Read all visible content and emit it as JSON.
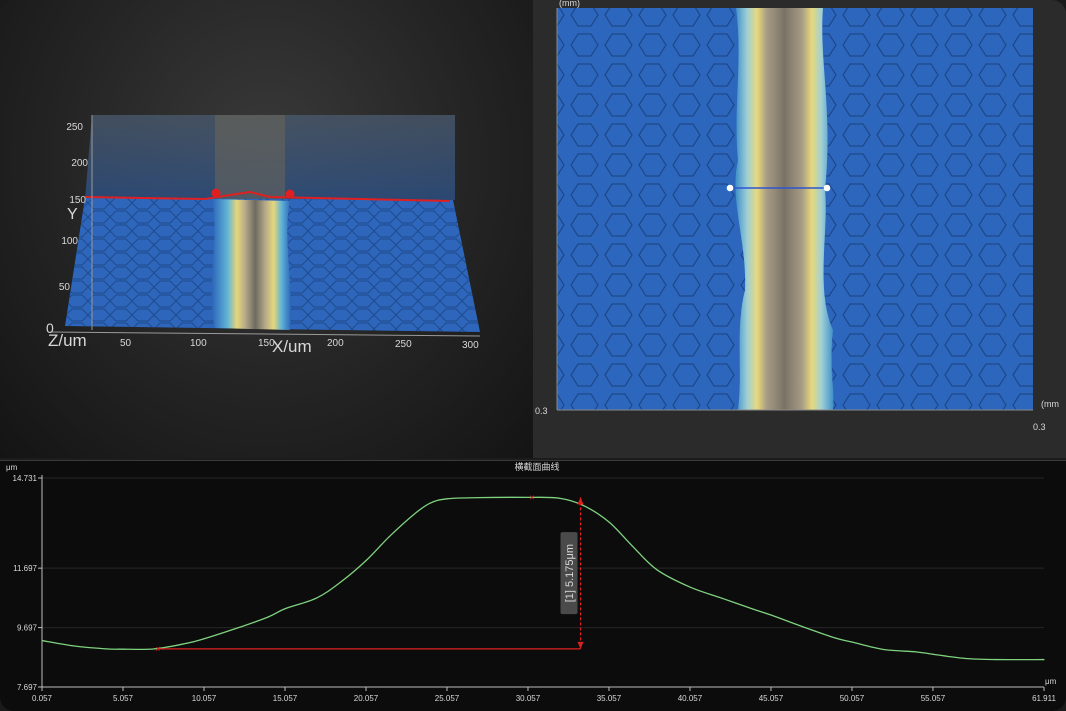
{
  "view3d": {
    "y_axis_label": "Y",
    "y_ticks": [
      "250",
      "200",
      "150",
      "100",
      "50"
    ],
    "z_origin_label": "0",
    "z_axis_label": "Z/um",
    "x_axis_label": "X/um",
    "x_ticks": [
      "50",
      "100",
      "150",
      "200",
      "250",
      "300"
    ],
    "section_line_color": "#e02020"
  },
  "view2d": {
    "top_unit_label": "(mm)",
    "right_unit_label": "(mm",
    "bottom_left_value": "0.3",
    "bottom_right_value": "0.3",
    "measure_line_color": "#2f55d0"
  },
  "profile": {
    "title": "横截面曲线",
    "y_unit": "μm",
    "x_unit": "μm",
    "y_ticks": [
      "14.731",
      "11.697",
      "9.697",
      "7.697"
    ],
    "x_ticks": [
      "0.057",
      "5.057",
      "10.057",
      "15.057",
      "20.057",
      "25.057",
      "30.057",
      "35.057",
      "40.057",
      "45.057",
      "50.057",
      "55.057",
      "61.911"
    ],
    "measurement_label": "[1] 5.175μm",
    "curve_color": "#7fd27f",
    "measure_color": "#e02020"
  },
  "chart_data": {
    "type": "line",
    "title": "横截面曲线",
    "xlabel": "μm",
    "ylabel": "μm",
    "xlim": [
      0.057,
      61.911
    ],
    "ylim": [
      7.697,
      14.731
    ],
    "series": [
      {
        "x": [
          0.057,
          2.0,
          4.0,
          5.057,
          7.0,
          9.0,
          10.057,
          12.0,
          14.0,
          15.057,
          17.0,
          18.5,
          20.057,
          21.5,
          23.0,
          24.0,
          25.057,
          27.0,
          30.057,
          32.0,
          33.5,
          35.057,
          36.5,
          38.0,
          40.057,
          42.0,
          44.0,
          45.057,
          47.0,
          49.0,
          50.057,
          52.0,
          54.0,
          55.057,
          57.0,
          59.0,
          61.911
        ],
        "y": [
          9.26,
          9.08,
          8.98,
          8.97,
          8.98,
          9.17,
          9.32,
          9.66,
          10.05,
          10.33,
          10.69,
          11.23,
          11.95,
          12.76,
          13.5,
          13.88,
          14.03,
          14.07,
          14.08,
          14.05,
          13.8,
          13.25,
          12.44,
          11.65,
          11.06,
          10.69,
          10.31,
          10.12,
          9.73,
          9.35,
          9.21,
          8.96,
          8.88,
          8.8,
          8.66,
          8.62,
          8.62
        ]
      }
    ],
    "measurement": {
      "x_start": 7.2,
      "x_end": 33.3,
      "y_low": 8.98,
      "y_high": 14.08,
      "value_label": "[1] 5.175μm"
    }
  }
}
